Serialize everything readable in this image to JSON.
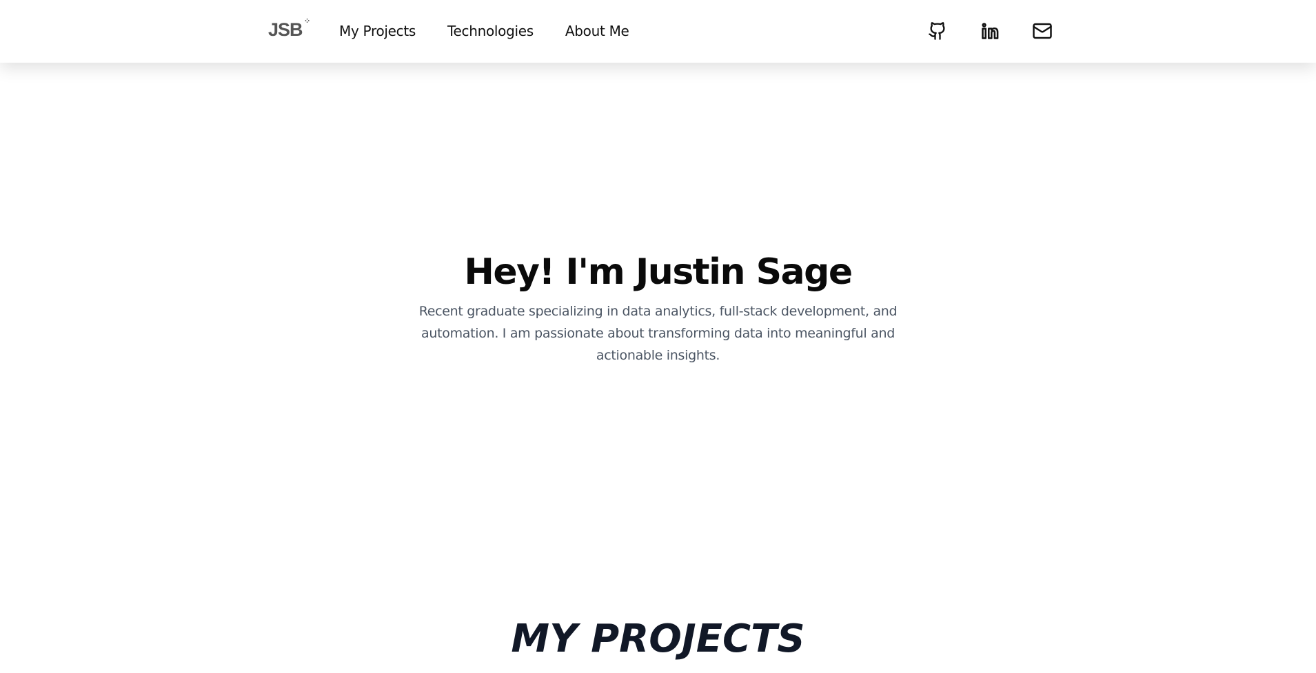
{
  "nav": {
    "logo": "JSB",
    "logo_mark": "⁘",
    "links": [
      {
        "label": "My Projects"
      },
      {
        "label": "Technologies"
      },
      {
        "label": "About Me"
      }
    ],
    "social": [
      {
        "icon": "github-icon"
      },
      {
        "icon": "linkedin-icon"
      },
      {
        "icon": "mail-icon"
      }
    ]
  },
  "hero": {
    "title": "Hey! I'm Justin Sage",
    "subtitle": "Recent graduate specializing in data analytics, full-stack development, and automation. I am passionate about transforming data into meaningful and actionable insights."
  },
  "projects": {
    "heading": "MY PROJECTS"
  },
  "colors": {
    "text": "#0a0a0a",
    "muted": "#4b5563",
    "heading": "#111827",
    "logo": "#555555"
  }
}
